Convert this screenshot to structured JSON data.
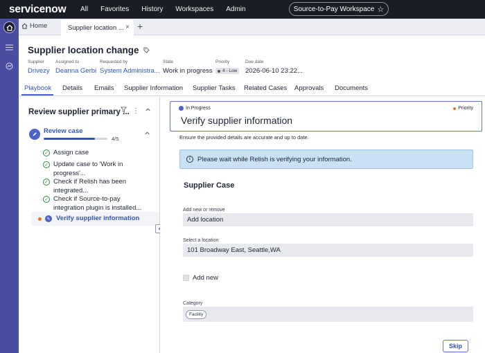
{
  "topnav": {
    "logo_main": "servicenow",
    "logo_suffix": ".",
    "links": [
      "All",
      "Favorites",
      "History",
      "Workspaces",
      "Admin"
    ],
    "workspace": "Source-to-Pay Workspace"
  },
  "rail": {
    "icons": [
      "home-icon",
      "list-icon",
      "dashboard-icon"
    ]
  },
  "tabs": {
    "home": "Home",
    "active": "Supplier location ...",
    "close": "×",
    "add": "+"
  },
  "header": {
    "title": "Supplier location change",
    "fields": [
      {
        "label": "Supplier",
        "value": "Drivezy"
      },
      {
        "label": "Assigned to",
        "value": "Deanna Gerbi"
      },
      {
        "label": "Requested by",
        "value": "System Administra..."
      },
      {
        "label": "State",
        "value": "Work in progress"
      },
      {
        "label": "Priority",
        "value": "4 - Low"
      },
      {
        "label": "Due date",
        "value": "2026-06-10 23:22..."
      }
    ]
  },
  "record_tabs": [
    "Playbook",
    "Details",
    "Emails",
    "Supplier Information",
    "Supplier Tasks",
    "Related Cases",
    "Approvals",
    "Documents"
  ],
  "playbook": {
    "title": "Review supplier primary ...",
    "stage": {
      "name": "Review case",
      "progress_text": "4/5",
      "progress": 0.8
    },
    "tasks": [
      "Assign case",
      "Update case to 'Work in progress'...",
      "Check if Relish has been integrated...",
      "Check if Source-to-pay integration plugin is installed..."
    ],
    "active_task": "Verify supplier information"
  },
  "main": {
    "status": "In Progress",
    "priority": "Priority",
    "heading": "Verify supplier information",
    "description": "Ensure the provided details are accurate and up to date.",
    "info": "Please wait while Relish is verifying your information.",
    "section": "Supplier Case",
    "add_label": "Add new or remove",
    "add_value": "Add location",
    "location_label": "Select a location",
    "location_value": "101 Broadway East, Seattle,WA",
    "checkbox_label": "Add new",
    "category_label": "Category",
    "category_chip": "Facility",
    "skip": "Skip"
  },
  "colors": {
    "accent": "#4c62c9",
    "rail": "#4a4ea0",
    "topnav": "#1a1d25",
    "info_bg": "#c9e0f5",
    "success": "#2e8a3e",
    "priority_dot": "#e07a1f"
  }
}
